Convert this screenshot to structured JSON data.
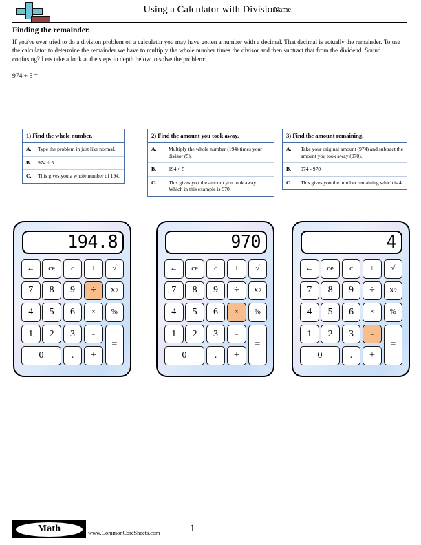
{
  "header": {
    "title": "Using a Calculator with Division",
    "name_label": "Name:",
    "logo_icon": "plus-minus-math-logo"
  },
  "intro": {
    "section_title": "Finding the remainder.",
    "body": "If you've ever tried to do a division problem on a calculator you may have gotten a number with a decimal. That decimal is actually the remainder. To use the calculator to determine the remainder we have to multiply the whole number times the divisor and then subtract that from the dividend. Sound confusing? Lets take a look at the steps in depth below to solve the problem:",
    "problem": "974 ÷ 5 ="
  },
  "steps": [
    {
      "heading": "1) Find the whole number.",
      "rows": [
        {
          "letter": "A.",
          "text": "Type the problem in just like normal."
        },
        {
          "letter": "B.",
          "text": "974 ÷ 5"
        },
        {
          "letter": "C.",
          "text": "This gives you a whole number of 194."
        }
      ]
    },
    {
      "heading": "2) Find the amount you took away.",
      "rows": [
        {
          "letter": "A.",
          "text": "Multiply the whole number (194) times your divisor (5)."
        },
        {
          "letter": "B.",
          "text": "194 × 5"
        },
        {
          "letter": "C.",
          "text": "This gives you the amount you took away. Which in this example is 970."
        }
      ]
    },
    {
      "heading": "3) Find the amount remaining.",
      "rows": [
        {
          "letter": "A.",
          "text": "Take your original amount (974) and subtract the amount you took away (970)."
        },
        {
          "letter": "B.",
          "text": "974 - 970"
        },
        {
          "letter": "C.",
          "text": "This gives you the number remaining which is 4."
        }
      ]
    }
  ],
  "calculators": [
    {
      "display": "194.8",
      "highlighted_key": "÷",
      "highlight_color": "#f7bd8c"
    },
    {
      "display": "970",
      "highlighted_key": "×",
      "highlight_color": "#f7bd8c"
    },
    {
      "display": "4",
      "highlighted_key": "-",
      "highlight_color": "#f7bd8c"
    }
  ],
  "keypad": {
    "keys": [
      "←",
      "ce",
      "c",
      "±",
      "√",
      "7",
      "8",
      "9",
      "÷",
      "x",
      "4",
      "5",
      "6",
      "×",
      "%",
      "1",
      "2",
      "3",
      "-",
      "=",
      "0",
      ".",
      "+"
    ],
    "square_exponent": "2"
  },
  "footer": {
    "badge": "Math",
    "url": "www.CommonCoreSheets.com",
    "page": "1"
  }
}
